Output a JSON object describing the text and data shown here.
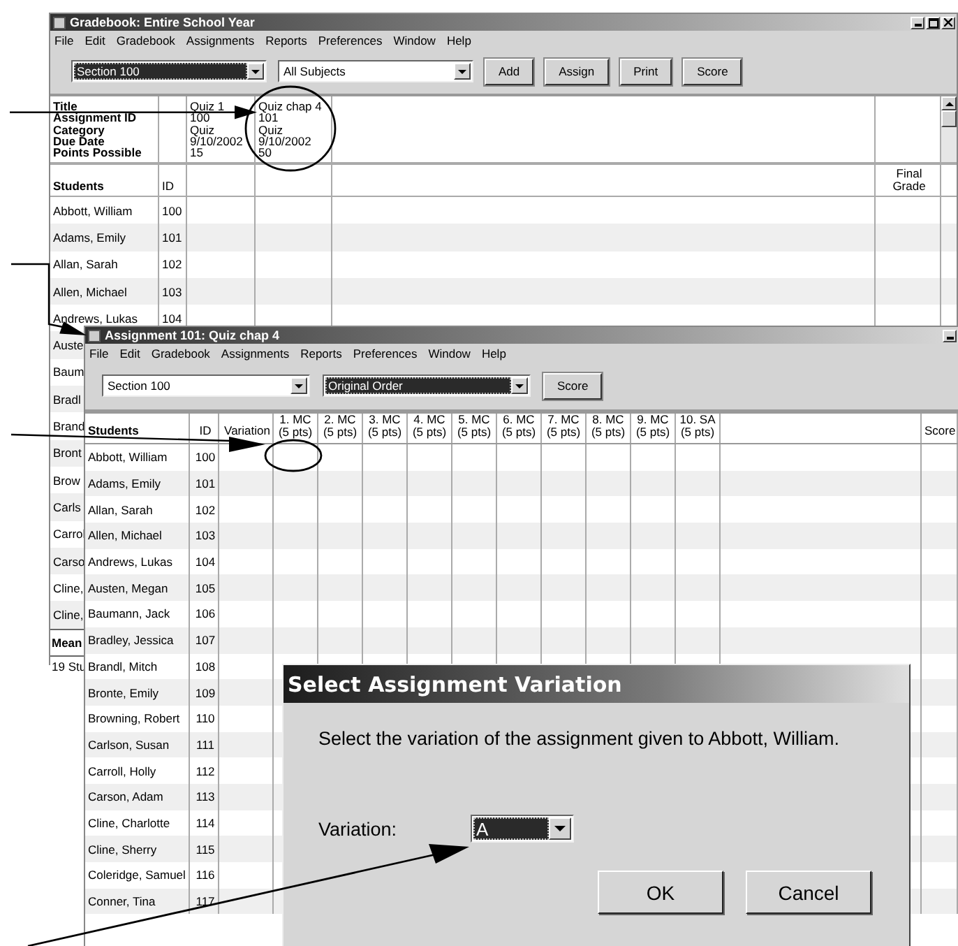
{
  "gradebook_window": {
    "title": "Gradebook: Entire School Year",
    "menu": [
      "File",
      "Edit",
      "Gradebook",
      "Assignments",
      "Reports",
      "Preferences",
      "Window",
      "Help"
    ],
    "selects": [
      {
        "value": "Section 100",
        "focused": true
      },
      {
        "value": "All Subjects",
        "focused": false
      }
    ],
    "buttons": [
      "Add",
      "Assign",
      "Print",
      "Score"
    ],
    "info_labels": [
      "Title",
      "Assignment ID",
      "Category",
      "Due Date",
      "Points Possible"
    ],
    "assignments": [
      {
        "fields": [
          "Quiz 1",
          "100",
          "Quiz",
          "9/10/2002",
          "15"
        ]
      },
      {
        "fields": [
          "Quiz chap 4",
          "101",
          "Quiz",
          "9/10/2002",
          "50"
        ]
      }
    ],
    "columns": {
      "students": "Students",
      "id": "ID",
      "final": "Final Grade"
    },
    "rows": [
      {
        "name": "Abbott, William",
        "id": "100"
      },
      {
        "name": "Adams, Emily",
        "id": "101"
      },
      {
        "name": "Allan, Sarah",
        "id": "102"
      },
      {
        "name": "Allen, Michael",
        "id": "103"
      },
      {
        "name": "Andrews, Lukas",
        "id": "104"
      },
      {
        "name": "Auste"
      },
      {
        "name": "Baum"
      },
      {
        "name": "Bradl"
      },
      {
        "name": "Brand"
      },
      {
        "name": "Bront"
      },
      {
        "name": "Brow"
      },
      {
        "name": "Carls"
      },
      {
        "name": "Carrol"
      },
      {
        "name": "Carso"
      },
      {
        "name": "Cline,"
      },
      {
        "name": "Cline,"
      }
    ],
    "summary": [
      {
        "kind": "mean",
        "label": "Mean"
      },
      {
        "kind": "count",
        "label": "19 Stu"
      }
    ]
  },
  "assignment_window": {
    "title": "Assignment 101: Quiz chap 4",
    "menu": [
      "File",
      "Edit",
      "Gradebook",
      "Assignments",
      "Reports",
      "Preferences",
      "Window",
      "Help"
    ],
    "selects": [
      {
        "value": "Section 100",
        "focused": false
      },
      {
        "value": "Original Order",
        "focused": true
      }
    ],
    "buttons": [
      "Score"
    ],
    "columns": {
      "students": "Students",
      "id": "ID",
      "variation": "Variation",
      "score": "Score"
    },
    "questions": [
      {
        "label": "1. MC",
        "points": "(5 pts)"
      },
      {
        "label": "2. MC",
        "points": "(5 pts)"
      },
      {
        "label": "3. MC",
        "points": "(5 pts)"
      },
      {
        "label": "4. MC",
        "points": "(5 pts)"
      },
      {
        "label": "5. MC",
        "points": "(5 pts)"
      },
      {
        "label": "6. MC",
        "points": "(5 pts)"
      },
      {
        "label": "7. MC",
        "points": "(5 pts)"
      },
      {
        "label": "8. MC",
        "points": "(5 pts)"
      },
      {
        "label": "9. MC",
        "points": "(5 pts)"
      },
      {
        "label": "10. SA",
        "points": "(5 pts)"
      }
    ],
    "rows": [
      {
        "name": "Abbott, William",
        "id": "100"
      },
      {
        "name": "Adams, Emily",
        "id": "101"
      },
      {
        "name": "Allan, Sarah",
        "id": "102"
      },
      {
        "name": "Allen, Michael",
        "id": "103"
      },
      {
        "name": "Andrews, Lukas",
        "id": "104"
      },
      {
        "name": "Austen, Megan",
        "id": "105"
      },
      {
        "name": "Baumann, Jack",
        "id": "106"
      },
      {
        "name": "Bradley, Jessica",
        "id": "107"
      },
      {
        "name": "Brandl, Mitch",
        "id": "108"
      },
      {
        "name": "Bronte, Emily",
        "id": "109"
      },
      {
        "name": "Browning, Robert",
        "id": "110"
      },
      {
        "name": "Carlson, Susan",
        "id": "111"
      },
      {
        "name": "Carroll, Holly",
        "id": "112"
      },
      {
        "name": "Carson, Adam",
        "id": "113"
      },
      {
        "name": "Cline, Charlotte",
        "id": "114"
      },
      {
        "name": "Cline, Sherry",
        "id": "115"
      },
      {
        "name": "Coleridge, Samuel",
        "id": "116"
      },
      {
        "name": "Conner, Tina",
        "id": "117"
      }
    ]
  },
  "dialog": {
    "title": "Select Assignment Variation",
    "message": "Select the variation of the assignment given to Abbott, William.",
    "field_label": "Variation:",
    "select": {
      "value": "A",
      "focused": true
    },
    "buttons": [
      "OK",
      "Cancel"
    ]
  }
}
